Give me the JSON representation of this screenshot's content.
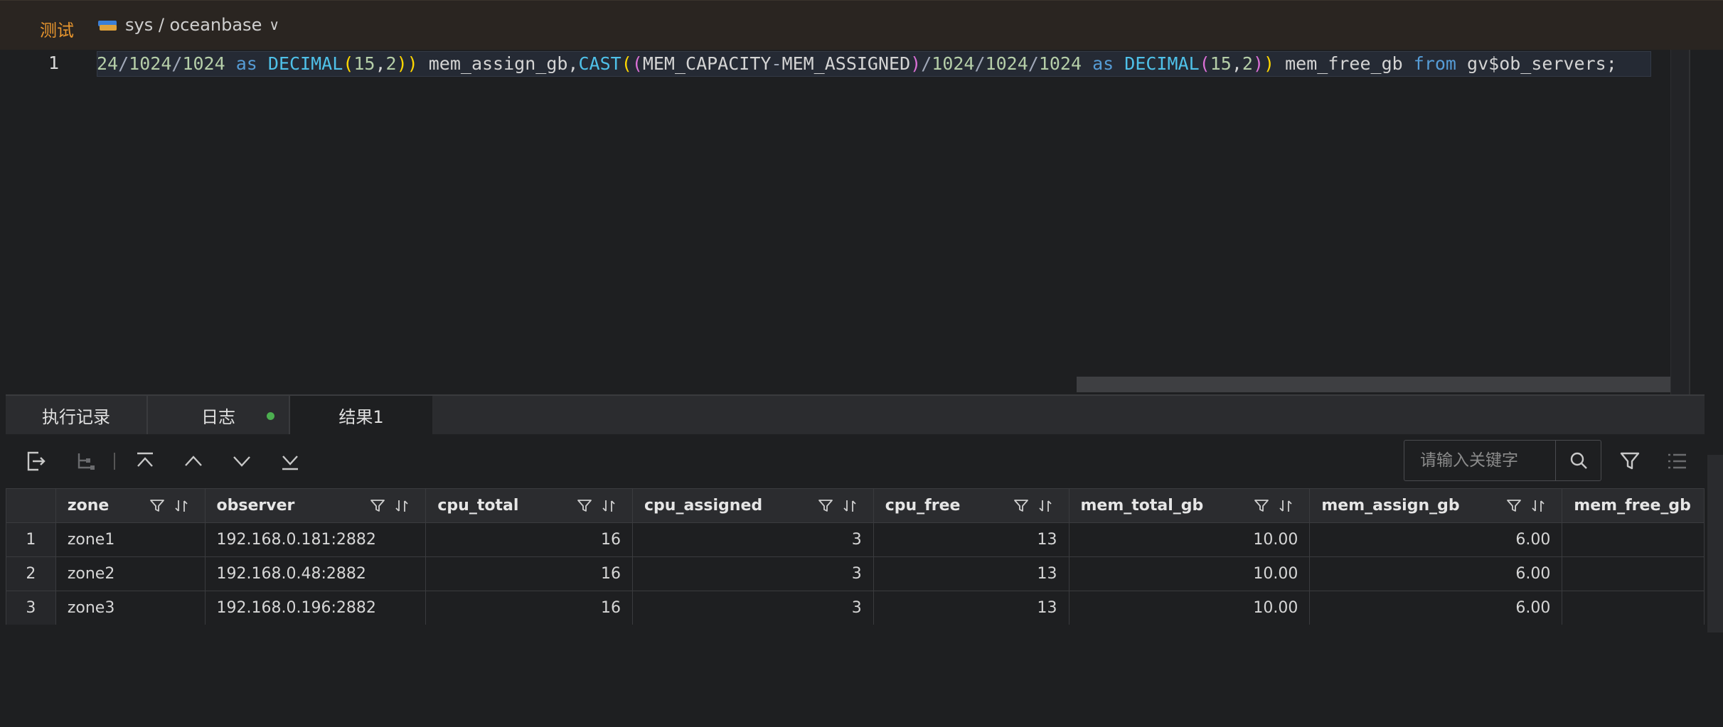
{
  "topbar": {
    "env_tag": "测试",
    "connection": "sys / oceanbase",
    "chevron": "∨"
  },
  "editor": {
    "line_number": "1",
    "sql_visible": "24/1024/1024 as DECIMAL(15,2)) mem_assign_gb,CAST((MEM_CAPACITY-MEM_ASSIGNED)/1024/1024/1024 as DECIMAL(15,2)) mem_free_gb from gv$ob_servers;"
  },
  "tabs": [
    {
      "label": "执行记录"
    },
    {
      "label": "日志"
    },
    {
      "label": "结果1"
    }
  ],
  "toolbar": {
    "search_placeholder": "请输入关键字"
  },
  "table": {
    "columns": [
      "zone",
      "observer",
      "cpu_total",
      "cpu_assigned",
      "cpu_free",
      "mem_total_gb",
      "mem_assign_gb",
      "mem_free_gb"
    ],
    "rows": [
      {
        "n": "1",
        "cells": [
          "zone1",
          "192.168.0.181:2882",
          "16",
          "3",
          "13",
          "10.00",
          "6.00",
          ""
        ]
      },
      {
        "n": "2",
        "cells": [
          "zone2",
          "192.168.0.48:2882",
          "16",
          "3",
          "13",
          "10.00",
          "6.00",
          ""
        ]
      },
      {
        "n": "3",
        "cells": [
          "zone3",
          "192.168.0.196:2882",
          "16",
          "3",
          "13",
          "10.00",
          "6.00",
          ""
        ]
      }
    ]
  },
  "colors": {
    "accent_orange": "#e8962e",
    "status_green": "#4caf50",
    "keyword_blue": "#569cd6"
  }
}
